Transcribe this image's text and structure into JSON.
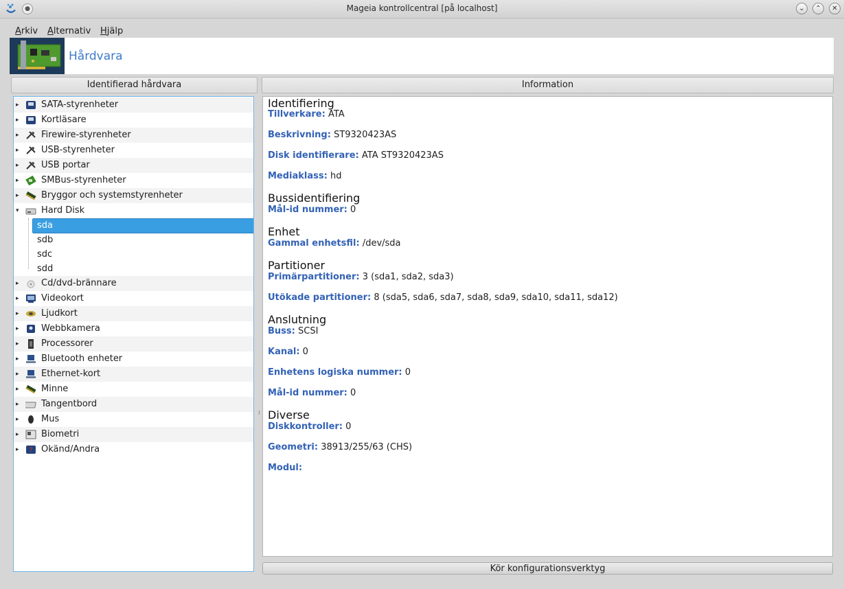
{
  "window": {
    "title": "Mageia kontrollcentral  [på localhost]",
    "pin_glyph": "●",
    "minimize_glyph": "⌄",
    "maximize_glyph": "⌃",
    "close_glyph": "✕"
  },
  "menubar": {
    "items": [
      {
        "accel": "A",
        "rest": "rkiv"
      },
      {
        "accel": "A",
        "rest": "lternativ"
      },
      {
        "accel": "H",
        "rest": "jälp"
      }
    ]
  },
  "banner": {
    "title": "Hårdvara"
  },
  "left_panel": {
    "header": "Identifierad hårdvara",
    "tree": [
      {
        "label": "SATA-styrenheter",
        "icon": "hard-drive-icon",
        "expanded": false
      },
      {
        "label": "Kortläsare",
        "icon": "card-reader-icon",
        "expanded": false
      },
      {
        "label": "Firewire-styrenheter",
        "icon": "plug-icon",
        "expanded": false
      },
      {
        "label": "USB-styrenheter",
        "icon": "usb-plug-icon",
        "expanded": false
      },
      {
        "label": "USB portar",
        "icon": "usb-plug-icon",
        "expanded": false
      },
      {
        "label": "SMBus-styrenheter",
        "icon": "smbus-icon",
        "expanded": false
      },
      {
        "label": "Bryggor och systemstyrenheter",
        "icon": "chip-icon",
        "expanded": false
      },
      {
        "label": "Hard Disk",
        "icon": "hard-disk-icon",
        "expanded": true,
        "children": [
          "sda",
          "sdb",
          "sdc",
          "sdd"
        ],
        "selected_child": "sda"
      },
      {
        "label": "Cd/dvd-brännare",
        "icon": "optical-disc-icon",
        "expanded": false
      },
      {
        "label": "Videokort",
        "icon": "video-card-icon",
        "expanded": false
      },
      {
        "label": "Ljudkort",
        "icon": "sound-card-icon",
        "expanded": false
      },
      {
        "label": "Webbkamera",
        "icon": "webcam-icon",
        "expanded": false
      },
      {
        "label": "Processorer",
        "icon": "cpu-icon",
        "expanded": false
      },
      {
        "label": "Bluetooth enheter",
        "icon": "bluetooth-icon",
        "expanded": false
      },
      {
        "label": "Ethernet-kort",
        "icon": "network-icon",
        "expanded": false
      },
      {
        "label": "Minne",
        "icon": "memory-icon",
        "expanded": false
      },
      {
        "label": "Tangentbord",
        "icon": "keyboard-icon",
        "expanded": false
      },
      {
        "label": "Mus",
        "icon": "mouse-icon",
        "expanded": false
      },
      {
        "label": "Biometri",
        "icon": "biometric-icon",
        "expanded": false
      },
      {
        "label": "Okänd/Andra",
        "icon": "unknown-device-icon",
        "expanded": false
      }
    ]
  },
  "right_panel": {
    "header": "Information",
    "sections": [
      {
        "title": "Identifiering",
        "fields": [
          {
            "key": "Tillverkare:",
            "value": "ATA"
          },
          {
            "key": "Beskrivning:",
            "value": "ST9320423AS"
          },
          {
            "key": "Disk identifierare:",
            "value": "ATA ST9320423AS"
          },
          {
            "key": "Mediaklass:",
            "value": "hd"
          }
        ]
      },
      {
        "title": "Bussidentifiering",
        "fields": [
          {
            "key": "Mål-id nummer:",
            "value": "0"
          }
        ]
      },
      {
        "title": "Enhet",
        "fields": [
          {
            "key": "Gammal enhetsfil:",
            "value": "/dev/sda"
          }
        ]
      },
      {
        "title": "Partitioner",
        "fields": [
          {
            "key": "Primärpartitioner:",
            "value": "3 (sda1, sda2, sda3)"
          },
          {
            "key": "Utökade partitioner:",
            "value": "8 (sda5, sda6, sda7, sda8, sda9, sda10, sda11, sda12)"
          }
        ]
      },
      {
        "title": "Anslutning",
        "fields": [
          {
            "key": "Buss:",
            "value": "SCSI"
          },
          {
            "key": "Kanal:",
            "value": "0"
          },
          {
            "key": "Enhetens logiska nummer:",
            "value": "0"
          },
          {
            "key": "Mål-id nummer:",
            "value": "0"
          }
        ]
      },
      {
        "title": "Diverse",
        "fields": [
          {
            "key": "Diskkontroller:",
            "value": "0"
          },
          {
            "key": "Geometri:",
            "value": "38913/255/63 (CHS)"
          },
          {
            "key": "Modul:",
            "value": ""
          }
        ]
      }
    ],
    "button_label": "Kör konfigurationsverktyg"
  },
  "colors": {
    "accent": "#3a9fe2",
    "field_key": "#3362b5",
    "banner_title": "#3d7ac8"
  }
}
